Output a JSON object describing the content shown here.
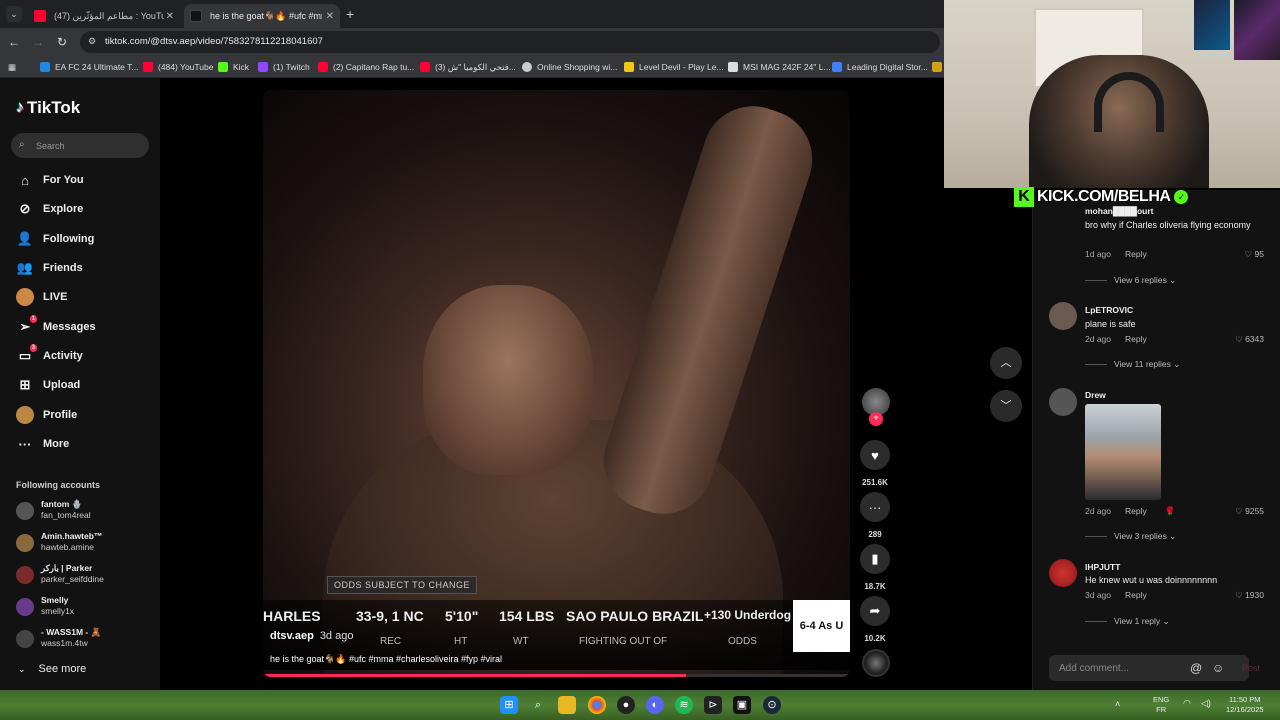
{
  "browser": {
    "tabs": [
      {
        "title": "(47) مطاعم المؤثّرين : YouTube",
        "favicon_color": "#ff0033",
        "active": false
      },
      {
        "title": "he is the goat🐐🔥 #ufc #mma",
        "favicon_color": "#111111",
        "active": true
      }
    ],
    "url": "tiktok.com/@dtsv.aep/video/7583278112218041607",
    "bookmarks": [
      {
        "label": "EA FC 24 Ultimate T...",
        "icon_color": "#1e88e5"
      },
      {
        "label": "(484) YouTube",
        "icon_color": "#ff0033"
      },
      {
        "label": "Kick",
        "icon_color": "#53fc18"
      },
      {
        "label": "(1) Twitch",
        "icon_color": "#9146ff"
      },
      {
        "label": "(2) Capitano Rap tu...",
        "icon_color": "#ff0033"
      },
      {
        "label": "(3) فتحي الكوميا \"ش...",
        "icon_color": "#ff0033"
      },
      {
        "label": "Online Shopping wi...",
        "icon_color": "#cccccc"
      },
      {
        "label": "Level Devil - Play Le...",
        "icon_color": "#f5c518"
      },
      {
        "label": "MSI MAG 242F 24\" L...",
        "icon_color": "#dddddd"
      },
      {
        "label": "Leading Digital Stor...",
        "icon_color": "#3b82f6"
      }
    ]
  },
  "sidebar": {
    "logo": "TikTok",
    "search_placeholder": "Search",
    "nav": [
      {
        "label": "For You",
        "icon": "home-icon"
      },
      {
        "label": "Explore",
        "icon": "compass-icon"
      },
      {
        "label": "Following",
        "icon": "following-icon"
      },
      {
        "label": "Friends",
        "icon": "friends-icon"
      },
      {
        "label": "LIVE",
        "icon": "live-icon"
      },
      {
        "label": "Messages",
        "icon": "messages-icon",
        "badge": "1"
      },
      {
        "label": "Activity",
        "icon": "activity-icon",
        "badge": "3"
      },
      {
        "label": "Upload",
        "icon": "upload-icon"
      },
      {
        "label": "Profile",
        "icon": "profile-icon"
      },
      {
        "label": "More",
        "icon": "more-icon"
      }
    ],
    "following_title": "Following accounts",
    "accounts": [
      {
        "name": "fantom 🪬",
        "handle": "fan_tom4real"
      },
      {
        "name": "Amin.hawteb™",
        "handle": "hawteb.amine"
      },
      {
        "name": "باركر | Parker",
        "handle": "parker_seifddine"
      },
      {
        "name": "Smelly",
        "handle": "smelly1x"
      },
      {
        "name": "- WASS1M - 🧸",
        "handle": "wass1m.4tw"
      }
    ],
    "see_more": "See more"
  },
  "video": {
    "odds_notice": "ODDS SUBJECT TO CHANGE",
    "stats": {
      "name": "HARLES",
      "record": "33-9, 1 NC",
      "height": "5'10\"",
      "weight": "154 LBS",
      "from": "SAO PAULO BRAZIL",
      "odds": "+130 Underdog",
      "label_rec": "REC",
      "label_ht": "HT",
      "label_wt": "WT",
      "label_from": "FIGHTING OUT OF",
      "label_odds": "ODDS",
      "box": "6-4 As U"
    },
    "author": "dtsv.aep",
    "date": "3d ago",
    "caption": "he is the goat🐐🔥 #ufc #mma #charlesoliveira #fyp #viral",
    "progress_fraction": 0.72
  },
  "actions": {
    "likes": "251.6K",
    "comments": "289",
    "saves": "18.7K",
    "shares": "10.2K"
  },
  "overlay": {
    "kick_text": "KICK.COM/BELHA"
  },
  "comments": [
    {
      "name": "mohan████ourt",
      "text": "bro why if Charles oliveria flying economy",
      "time": "1d ago",
      "likes": "95",
      "view_replies": "View 6 replies"
    },
    {
      "name": "LpETROVIC",
      "text": "plane is safe",
      "time": "2d ago",
      "likes": "6343",
      "view_replies": "View 11 replies"
    },
    {
      "name": "Drew",
      "text": "",
      "time": "2d ago",
      "likes": "9255",
      "view_replies": "View 3 replies"
    },
    {
      "name": "IHPJUTT",
      "text": "He knew wut u was doinnnnnnnn",
      "time": "3d ago",
      "likes": "1930",
      "view_replies": "View 1 reply"
    }
  ],
  "comment_ui": {
    "reply": "Reply",
    "placeholder": "Add comment...",
    "post": "Post"
  },
  "taskbar": {
    "lang_top": "ENG",
    "lang_bottom": "FR",
    "time": "11:50 PM",
    "date": "12/16/2025"
  }
}
